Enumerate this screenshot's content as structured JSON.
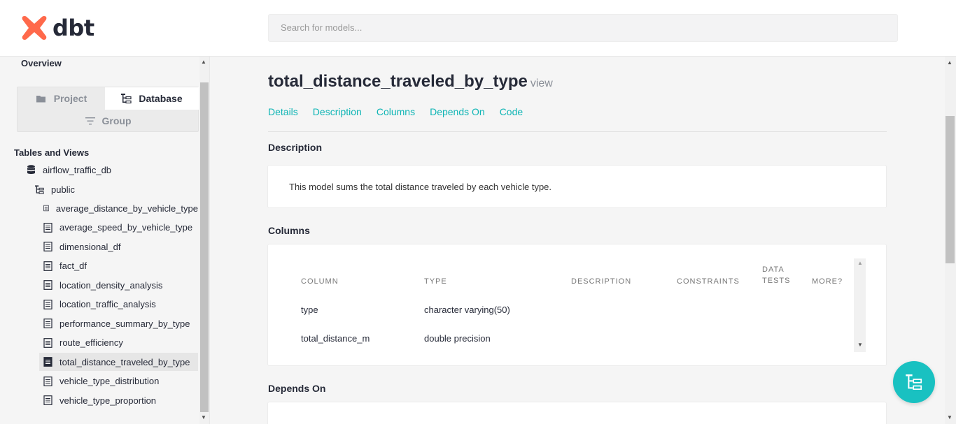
{
  "header": {
    "logo_text": "dbt",
    "search_placeholder": "Search for models..."
  },
  "sidebar": {
    "overview": "Overview",
    "tabs": {
      "project": "Project",
      "database": "Database",
      "group": "Group"
    },
    "tables_title": "Tables and Views",
    "database_name": "airflow_traffic_db",
    "schema_name": "public",
    "items": [
      {
        "label": "average_distance_by_vehicle_type"
      },
      {
        "label": "average_speed_by_vehicle_type"
      },
      {
        "label": "dimensional_df"
      },
      {
        "label": "fact_df"
      },
      {
        "label": "location_density_analysis"
      },
      {
        "label": "location_traffic_analysis"
      },
      {
        "label": "performance_summary_by_type"
      },
      {
        "label": "route_efficiency"
      },
      {
        "label": "total_distance_traveled_by_type",
        "active": true
      },
      {
        "label": "vehicle_type_distribution"
      },
      {
        "label": "vehicle_type_proportion"
      }
    ]
  },
  "main": {
    "title": "total_distance_traveled_by_type",
    "type": "view",
    "nav": [
      "Details",
      "Description",
      "Columns",
      "Depends On",
      "Code"
    ],
    "description_title": "Description",
    "description_text": "This model sums the total distance traveled by each vehicle type.",
    "columns_title": "Columns",
    "columns_table": {
      "headers": {
        "column": "COLUMN",
        "type": "TYPE",
        "description": "DESCRIPTION",
        "constraints": "CONSTRAINTS",
        "data_tests_1": "DATA",
        "data_tests_2": "TESTS",
        "more": "MORE?"
      },
      "rows": [
        {
          "column": "type",
          "type": "character varying(50)"
        },
        {
          "column": "total_distance_m",
          "type": "double precision"
        }
      ]
    },
    "depends_on_title": "Depends On"
  },
  "colors": {
    "accent": "#0fb5b5",
    "logo": "#ff694b",
    "fab": "#19c1c1"
  }
}
